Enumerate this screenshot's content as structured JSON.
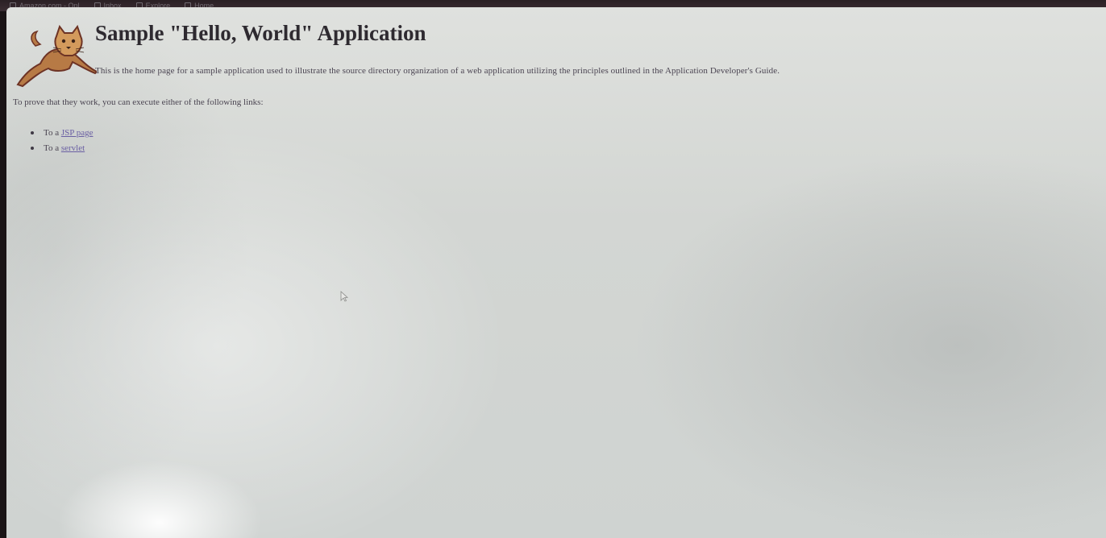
{
  "browser": {
    "bookmarks": [
      {
        "label": "Amazon.com - Onl",
        "icon": "bookmark-icon"
      },
      {
        "label": "Inbox",
        "icon": "bookmark-icon"
      },
      {
        "label": "Explore",
        "icon": "bookmark-icon"
      },
      {
        "label": "Home",
        "icon": "bookmark-icon"
      }
    ]
  },
  "page": {
    "title": "Sample \"Hello, World\" Application",
    "intro": "This is the home page for a sample application used to illustrate the source directory organization of a web application utilizing the principles outlined in the Application Developer's Guide.",
    "prove_text": "To prove that they work, you can execute either of the following links:",
    "links": [
      {
        "prefix": "To a ",
        "link_text": "JSP page"
      },
      {
        "prefix": "To a ",
        "link_text": "servlet"
      }
    ]
  },
  "logo": {
    "name": "tomcat-logo",
    "colors": {
      "body": "#c98a4b",
      "outline": "#7a3a2a",
      "face": "#d9a060"
    }
  }
}
